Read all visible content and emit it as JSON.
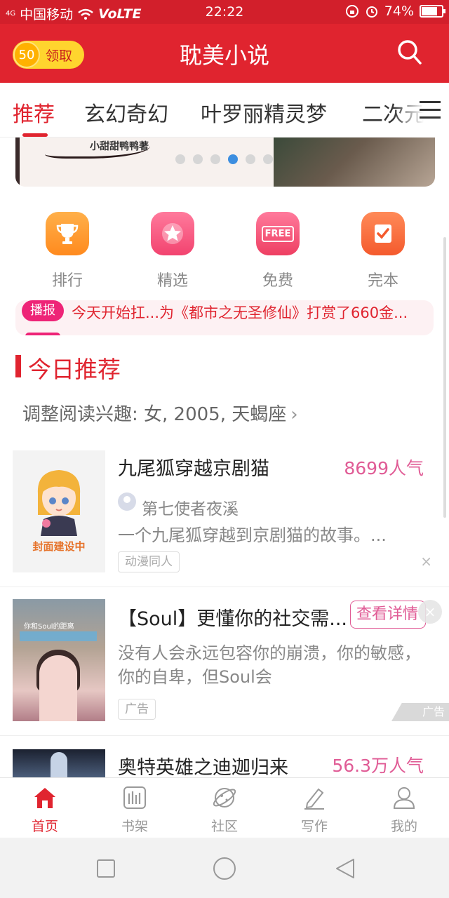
{
  "status_bar": {
    "signal": "4G",
    "carrier": "中国移动",
    "network": "VoLTE",
    "time": "22:22",
    "battery": "74%"
  },
  "header": {
    "coin_value": "50",
    "claim_label": "领取",
    "title": "耽美小说",
    "search_icon": "search-icon"
  },
  "tabs": [
    {
      "label": "推荐",
      "active": true
    },
    {
      "label": "玄幻奇幻",
      "active": false
    },
    {
      "label": "叶罗丽精灵梦",
      "active": false
    },
    {
      "label": "二次元",
      "active": false
    }
  ],
  "banner": {
    "author_text": "小甜甜鸭鸭著",
    "dot_count": 6,
    "active_dot": 4
  },
  "quick_links": [
    {
      "label": "排行",
      "icon": "trophy-icon"
    },
    {
      "label": "精选",
      "icon": "star-icon"
    },
    {
      "label": "免费",
      "icon": "free-tag-icon",
      "badge": "FREE"
    },
    {
      "label": "完本",
      "icon": "checkmark-book-icon"
    }
  ],
  "broadcast": {
    "badge": "播报",
    "text": "今天开始扛...为《都市之无圣修仙》打赏了660金..."
  },
  "section": {
    "title": "今日推荐",
    "subtitle": "调整阅读兴趣: 女, 2005, 天蝎座",
    "chevron": "›"
  },
  "books": [
    {
      "title": "九尾狐穿越京剧猫",
      "popularity": "8699人气",
      "author": "第七使者夜溪",
      "description": "一个九尾狐穿越到京剧猫的故事。...",
      "tag": "动漫同人",
      "cover_text": "封面建设中",
      "close": "×"
    },
    {
      "title": "奥特英雄之迪迦归来",
      "popularity": "56.3万人气"
    }
  ],
  "ad": {
    "title": "【Soul】更懂你的社交需...",
    "description": "没有人会永远包容你的崩溃，你的敏感，你的自卑，但Soul会",
    "button": "查看详情",
    "tag": "广告",
    "mark": "广告",
    "close": "×",
    "cover_line": "你和Soul的距离"
  },
  "bottom_nav": [
    {
      "label": "首页",
      "icon": "home-icon",
      "active": true
    },
    {
      "label": "书架",
      "icon": "bookshelf-icon",
      "active": false
    },
    {
      "label": "社区",
      "icon": "planet-icon",
      "active": false
    },
    {
      "label": "写作",
      "icon": "pen-icon",
      "active": false
    },
    {
      "label": "我的",
      "icon": "user-icon",
      "active": false
    }
  ],
  "colors": {
    "brand_red": "#e0242f",
    "accent_pink": "#e05b95",
    "broadcast_pink": "#ee2477"
  }
}
